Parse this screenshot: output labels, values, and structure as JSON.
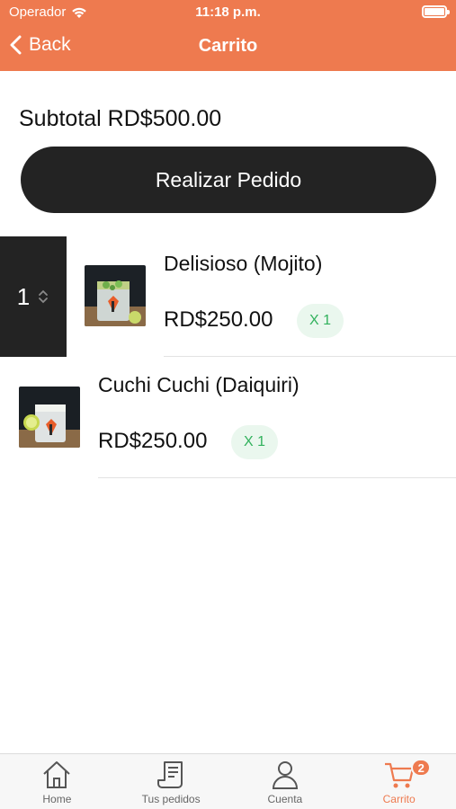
{
  "status_bar": {
    "carrier": "Operador",
    "time": "11:18 p.m."
  },
  "nav": {
    "back_label": "Back",
    "title": "Carrito"
  },
  "cart": {
    "subtotal_text": "Subtotal RD$500.00",
    "order_button_label": "Realizar Pedido",
    "selected_quantity": "1",
    "items": [
      {
        "name": "Delisioso (Mojito)",
        "price": "RD$250.00",
        "quantity": "X 1"
      },
      {
        "name": "Cuchi Cuchi (Daiquiri)",
        "price": "RD$250.00",
        "quantity": "X 1"
      }
    ]
  },
  "tabs": [
    {
      "label": "Home",
      "icon": "home-icon"
    },
    {
      "label": "Tus pedidos",
      "icon": "receipt-icon"
    },
    {
      "label": "Cuenta",
      "icon": "user-icon"
    },
    {
      "label": "Carrito",
      "icon": "cart-icon",
      "badge": "2",
      "active": true
    }
  ],
  "colors": {
    "accent": "#ee7a4f",
    "dark_button": "#232323",
    "badge_green": "#31b15c",
    "badge_green_bg": "#eaf7ee"
  }
}
